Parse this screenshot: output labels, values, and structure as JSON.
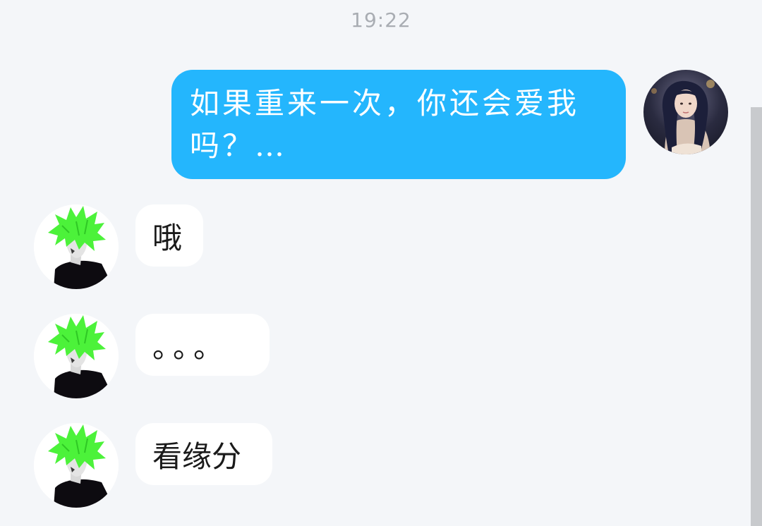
{
  "status": {
    "time": "19:22"
  },
  "messages": [
    {
      "sender": "self",
      "text": "如果重来一次，你还会爱我吗？…",
      "avatar_icon": "girl-avatar-icon"
    },
    {
      "sender": "other",
      "text": "哦",
      "avatar_icon": "green-hair-boy-avatar-icon"
    },
    {
      "sender": "other",
      "text": "。。。",
      "avatar_icon": "green-hair-boy-avatar-icon"
    },
    {
      "sender": "other",
      "text": "看缘分",
      "avatar_icon": "green-hair-boy-avatar-icon"
    }
  ],
  "colors": {
    "outgoing_bubble": "#24b6fd",
    "incoming_bubble": "#ffffff",
    "background": "#f4f6f9",
    "hair_green": "#4cf23a"
  }
}
